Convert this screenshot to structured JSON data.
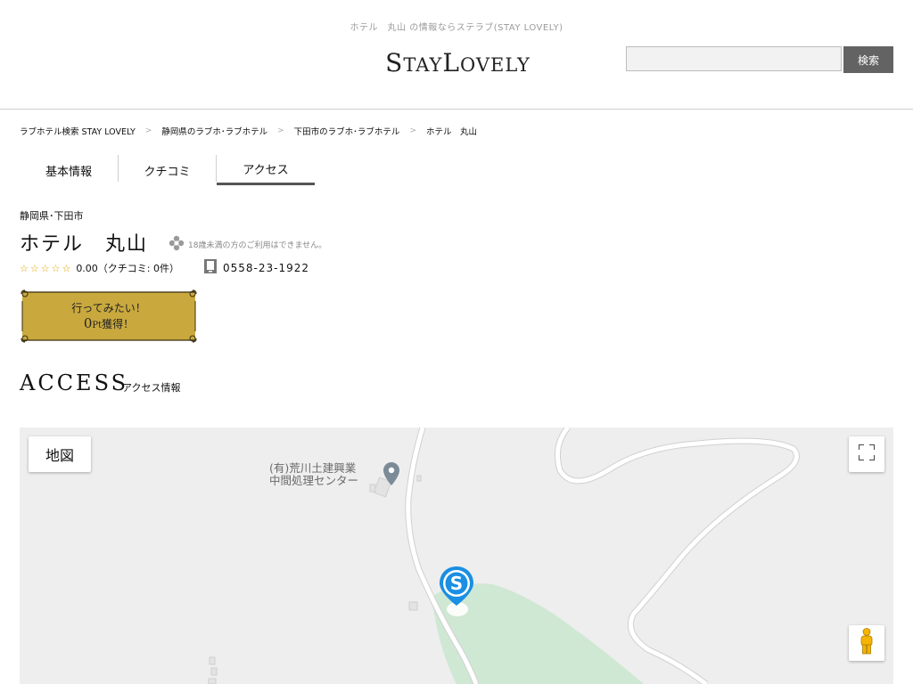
{
  "header": {
    "tagline": "ホテル　丸山 の情報ならステラブ(STAY LOVELY)",
    "logo": {
      "s": "S",
      "tay": "TAY",
      "l": "L",
      "ovely": "OVELY"
    },
    "search": {
      "placeholder": "",
      "value": "",
      "button_label": "検索"
    }
  },
  "breadcrumb": [
    {
      "label": "ラブホテル検索 STAY LOVELY"
    },
    {
      "label": "静岡県のラブホ･ラブホテル"
    },
    {
      "label": "下田市のラブホ･ラブホテル"
    },
    {
      "label": "ホテル　丸山"
    }
  ],
  "breadcrumb_separator": ">",
  "tabs": [
    {
      "label": "基本情報",
      "active": false
    },
    {
      "label": "クチコミ",
      "active": false
    },
    {
      "label": "アクセス",
      "active": true
    }
  ],
  "hotel": {
    "location": "静岡県･下田市",
    "name": "ホテル　丸山",
    "age_note": "18歳未満の方のご利用はできません。",
    "stars": "☆☆☆☆☆",
    "rating_text": "0.00（クチコミ: 0件）",
    "phone": "0558-23-1922"
  },
  "want_button": {
    "line1": "行ってみたい！",
    "points": "0",
    "pt_unit": "Pt",
    "suffix": "獲得！"
  },
  "access": {
    "heading": "ACCESS",
    "subheading": "アクセス情報"
  },
  "map": {
    "type_button": "地図",
    "poi_label": "(有)荒川土建興業\n中間処理センター",
    "colors": {
      "background": "#eeeeee",
      "park": "#cfe8d4",
      "road": "#ffffff",
      "marker": "#1a8fe3"
    },
    "icons": {
      "fullscreen": "fullscreen-icon",
      "pegman": "pegman-icon",
      "marker": "hotel-marker-icon",
      "poi": "poi-pin-icon"
    }
  }
}
